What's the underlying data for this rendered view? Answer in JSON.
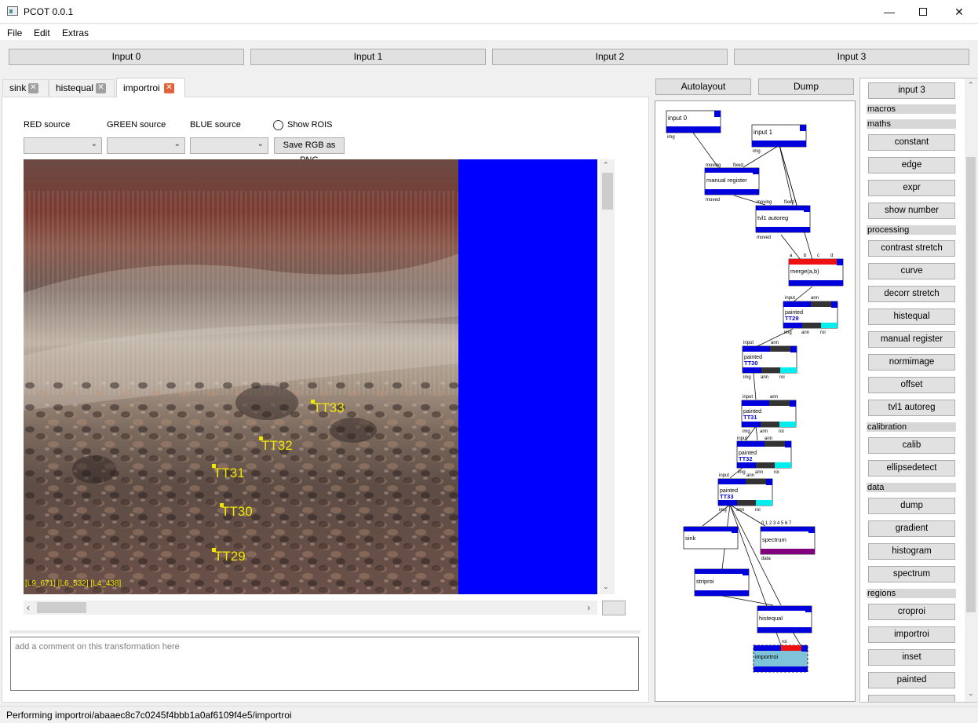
{
  "window": {
    "title": "PCOT 0.0.1"
  },
  "menu": [
    "File",
    "Edit",
    "Extras"
  ],
  "inputs": [
    "Input 0",
    "Input 1",
    "Input 2",
    "Input 3"
  ],
  "tabs": [
    "sink",
    "histequal",
    "importroi"
  ],
  "active_tab": "importroi",
  "panel": {
    "red_label": "RED source",
    "green_label": "GREEN source",
    "blue_label": "BLUE source",
    "show_rois": "Show ROIS",
    "save_button": "Save RGB as PNG",
    "roi_labels": [
      "TT33",
      "TT32",
      "TT31",
      "TT30",
      "TT29"
    ],
    "coord_readout": "[L9_671] [L6_532] [L4_438]",
    "comment_placeholder": "add a comment on this transformation here"
  },
  "graph_buttons": [
    "Autolayout",
    "Dump"
  ],
  "graph": {
    "nodes": {
      "input0": "input 0",
      "input1": "input 1",
      "manual_register": "manual register",
      "tvl1": "tvl1 autoreg",
      "merge": "merge(a,b)",
      "painted29": "painted",
      "painted30": "painted",
      "painted31": "painted",
      "painted32": "painted",
      "painted33": "painted",
      "sink": "sink",
      "spectrum": "spectrum",
      "striproi": "striproi",
      "histequal": "histequal",
      "importroi": "importroi"
    },
    "tags": {
      "tt29": "TT29",
      "tt30": "TT30",
      "tt31": "TT31",
      "tt32": "TT32",
      "tt33": "TT33"
    },
    "ports": {
      "img": "img",
      "moved": "moved",
      "moving_img": "moving",
      "fixed": "fixed",
      "a": "a",
      "b": "b",
      "c": "c",
      "d": "d",
      "input": "input",
      "ann": "ann",
      "roi": "roi",
      "data": "data",
      "spectrum_inputs": "0 1 2 3 4 5 6 7"
    }
  },
  "palette": {
    "top_button": "input 3",
    "sections": [
      {
        "header": "macros",
        "items": []
      },
      {
        "header": "maths",
        "items": [
          "constant",
          "edge",
          "expr",
          "show number"
        ]
      },
      {
        "header": "processing",
        "items": [
          "contrast stretch",
          "curve",
          "decorr stretch",
          "histequal",
          "manual register",
          "normimage",
          "offset",
          "tvl1 autoreg"
        ]
      },
      {
        "header": "calibration",
        "items": [
          "calib",
          "ellipsedetect"
        ]
      },
      {
        "header": "data",
        "items": [
          "dump",
          "gradient",
          "histogram",
          "spectrum"
        ]
      },
      {
        "header": "regions",
        "items": [
          "croproi",
          "importroi",
          "inset",
          "painted"
        ]
      }
    ]
  },
  "status": "Performing importroi/abaaec8c7c0245f4bbb1a0af6109f4e5/importroi",
  "colors": {
    "node_blue": "#0000dd",
    "roi_yellow": "#f2e600",
    "tab_close_active": "#e0653d",
    "node_red": "#ee1111",
    "node_cyan": "#00eeee"
  }
}
